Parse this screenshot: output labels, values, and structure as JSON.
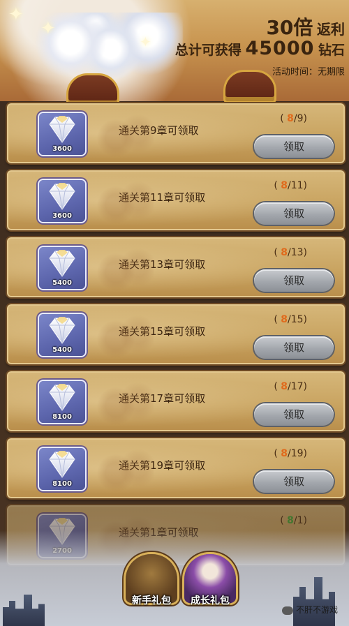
{
  "header": {
    "multiplier": "30倍",
    "multiplier_suffix": "返利",
    "total_prefix": "总计可获得",
    "total_amount": "45000",
    "total_unit": "钻石",
    "activity_time": "活动时间：无期限"
  },
  "claim_label": "领取",
  "rewards": [
    {
      "qty": "3600",
      "task": "通关第9章可领取",
      "current": "8",
      "target": "9",
      "progress_text": "/9)"
    },
    {
      "qty": "3600",
      "task": "通关第11章可领取",
      "current": "8",
      "target": "11",
      "progress_text": "/11)"
    },
    {
      "qty": "5400",
      "task": "通关第13章可领取",
      "current": "8",
      "target": "13",
      "progress_text": "/13)"
    },
    {
      "qty": "5400",
      "task": "通关第15章可领取",
      "current": "8",
      "target": "15",
      "progress_text": "/15)"
    },
    {
      "qty": "8100",
      "task": "通关第17章可领取",
      "current": "8",
      "target": "17",
      "progress_text": "/17)"
    },
    {
      "qty": "8100",
      "task": "通关第19章可领取",
      "current": "8",
      "target": "19",
      "progress_text": "/19)"
    },
    {
      "qty": "2700",
      "task": "通关第1章可领取",
      "current": "8",
      "target": "1",
      "progress_text": "/1)"
    }
  ],
  "bottom_nav": {
    "newbie_pack": "新手礼包",
    "growth_pack": "成长礼包"
  },
  "watermark": "不肝不游戏",
  "colors": {
    "progress_current": "#e06a1c",
    "progress_done": "#3fae3a",
    "claim_button": "#a3a7ad"
  }
}
